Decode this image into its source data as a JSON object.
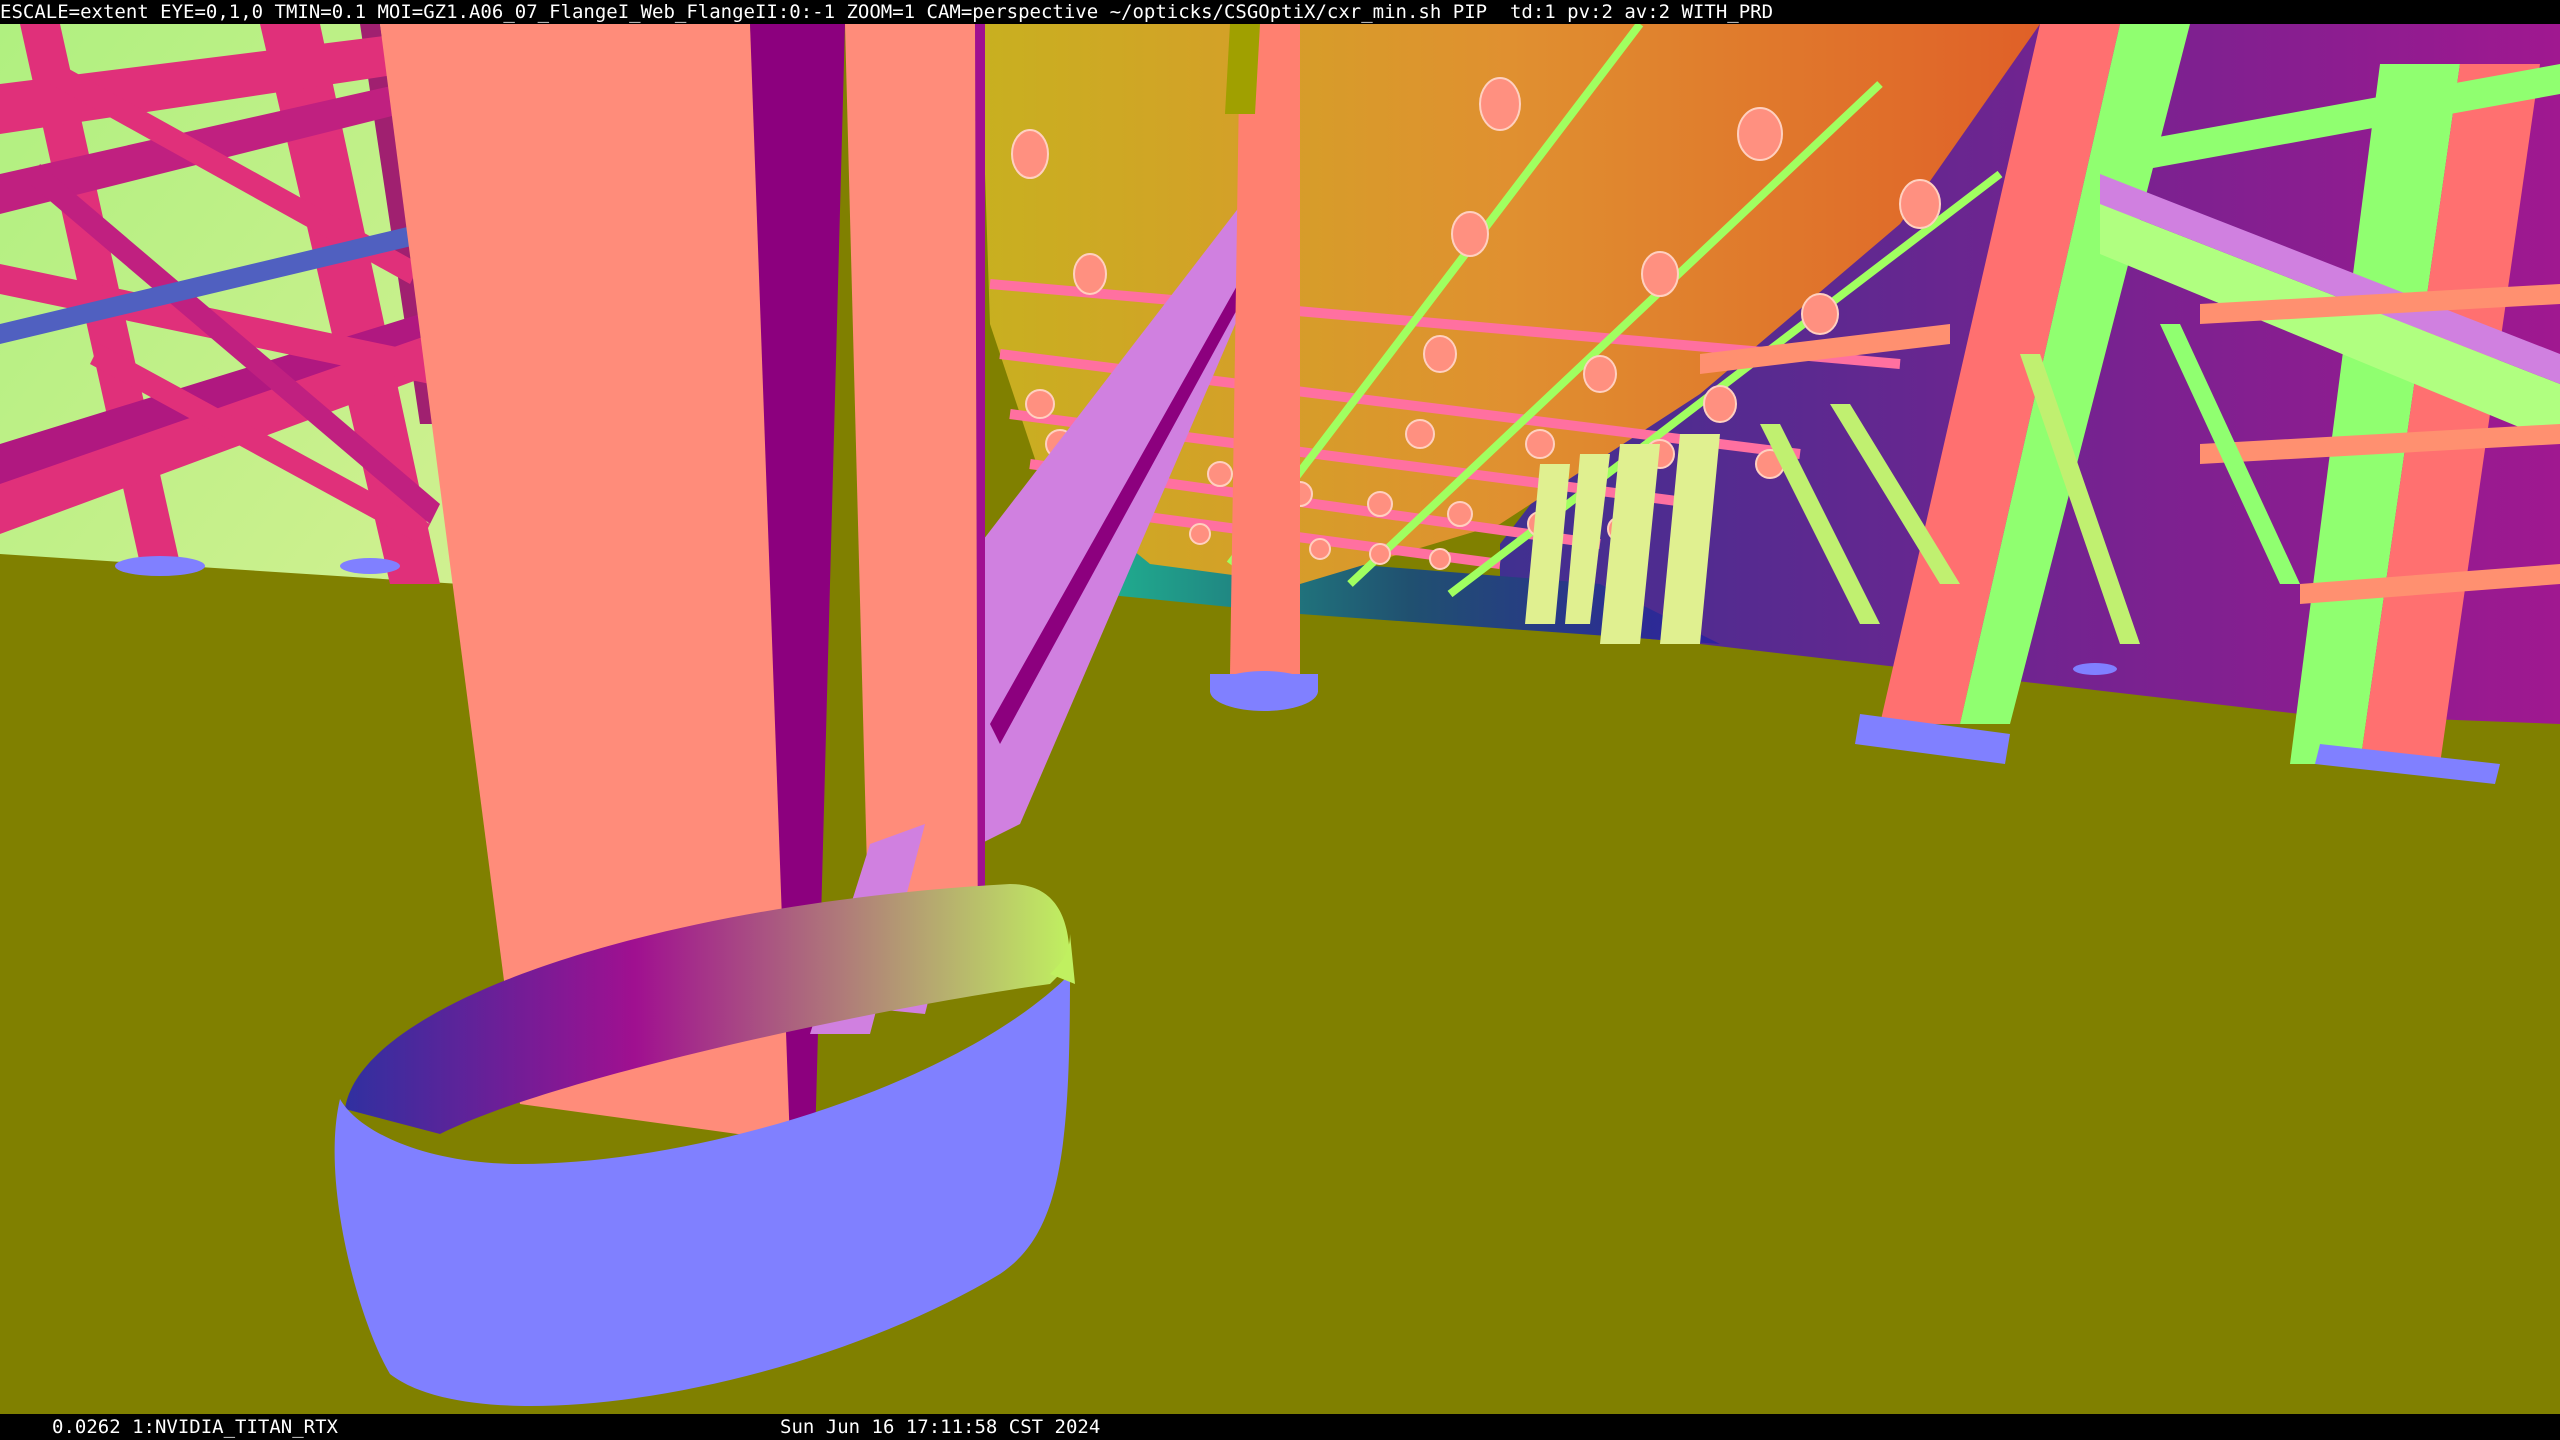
{
  "header": {
    "status_line": "ESCALE=extent EYE=0,1,0 TMIN=0.1 MOI=GZ1.A06_07_FlangeI_Web_FlangeII:0:-1 ZOOM=1 CAM=perspective ~/opticks/CSGOptiX/cxr_min.sh PIP  td:1 pv:2 av:2 WITH_PRD"
  },
  "footer": {
    "timing_device": "0.0262 1:NVIDIA_TITAN_RTX",
    "timestamp": "Sun Jun 16 17:11:58 CST 2024"
  },
  "render": {
    "floor_color": "#808000",
    "background_colors": [
      "#b8e880",
      "#a8f078"
    ],
    "ceiling_colors": [
      "#b8a820",
      "#e08830",
      "#e06020"
    ],
    "beam_color": "#ff8c7a",
    "beam_shadow_color": "#8c007e",
    "base_ring_color": "#8080ff",
    "truss_colors": [
      "#e0307a",
      "#c02080",
      "#90ff70",
      "#ff7090"
    ]
  }
}
